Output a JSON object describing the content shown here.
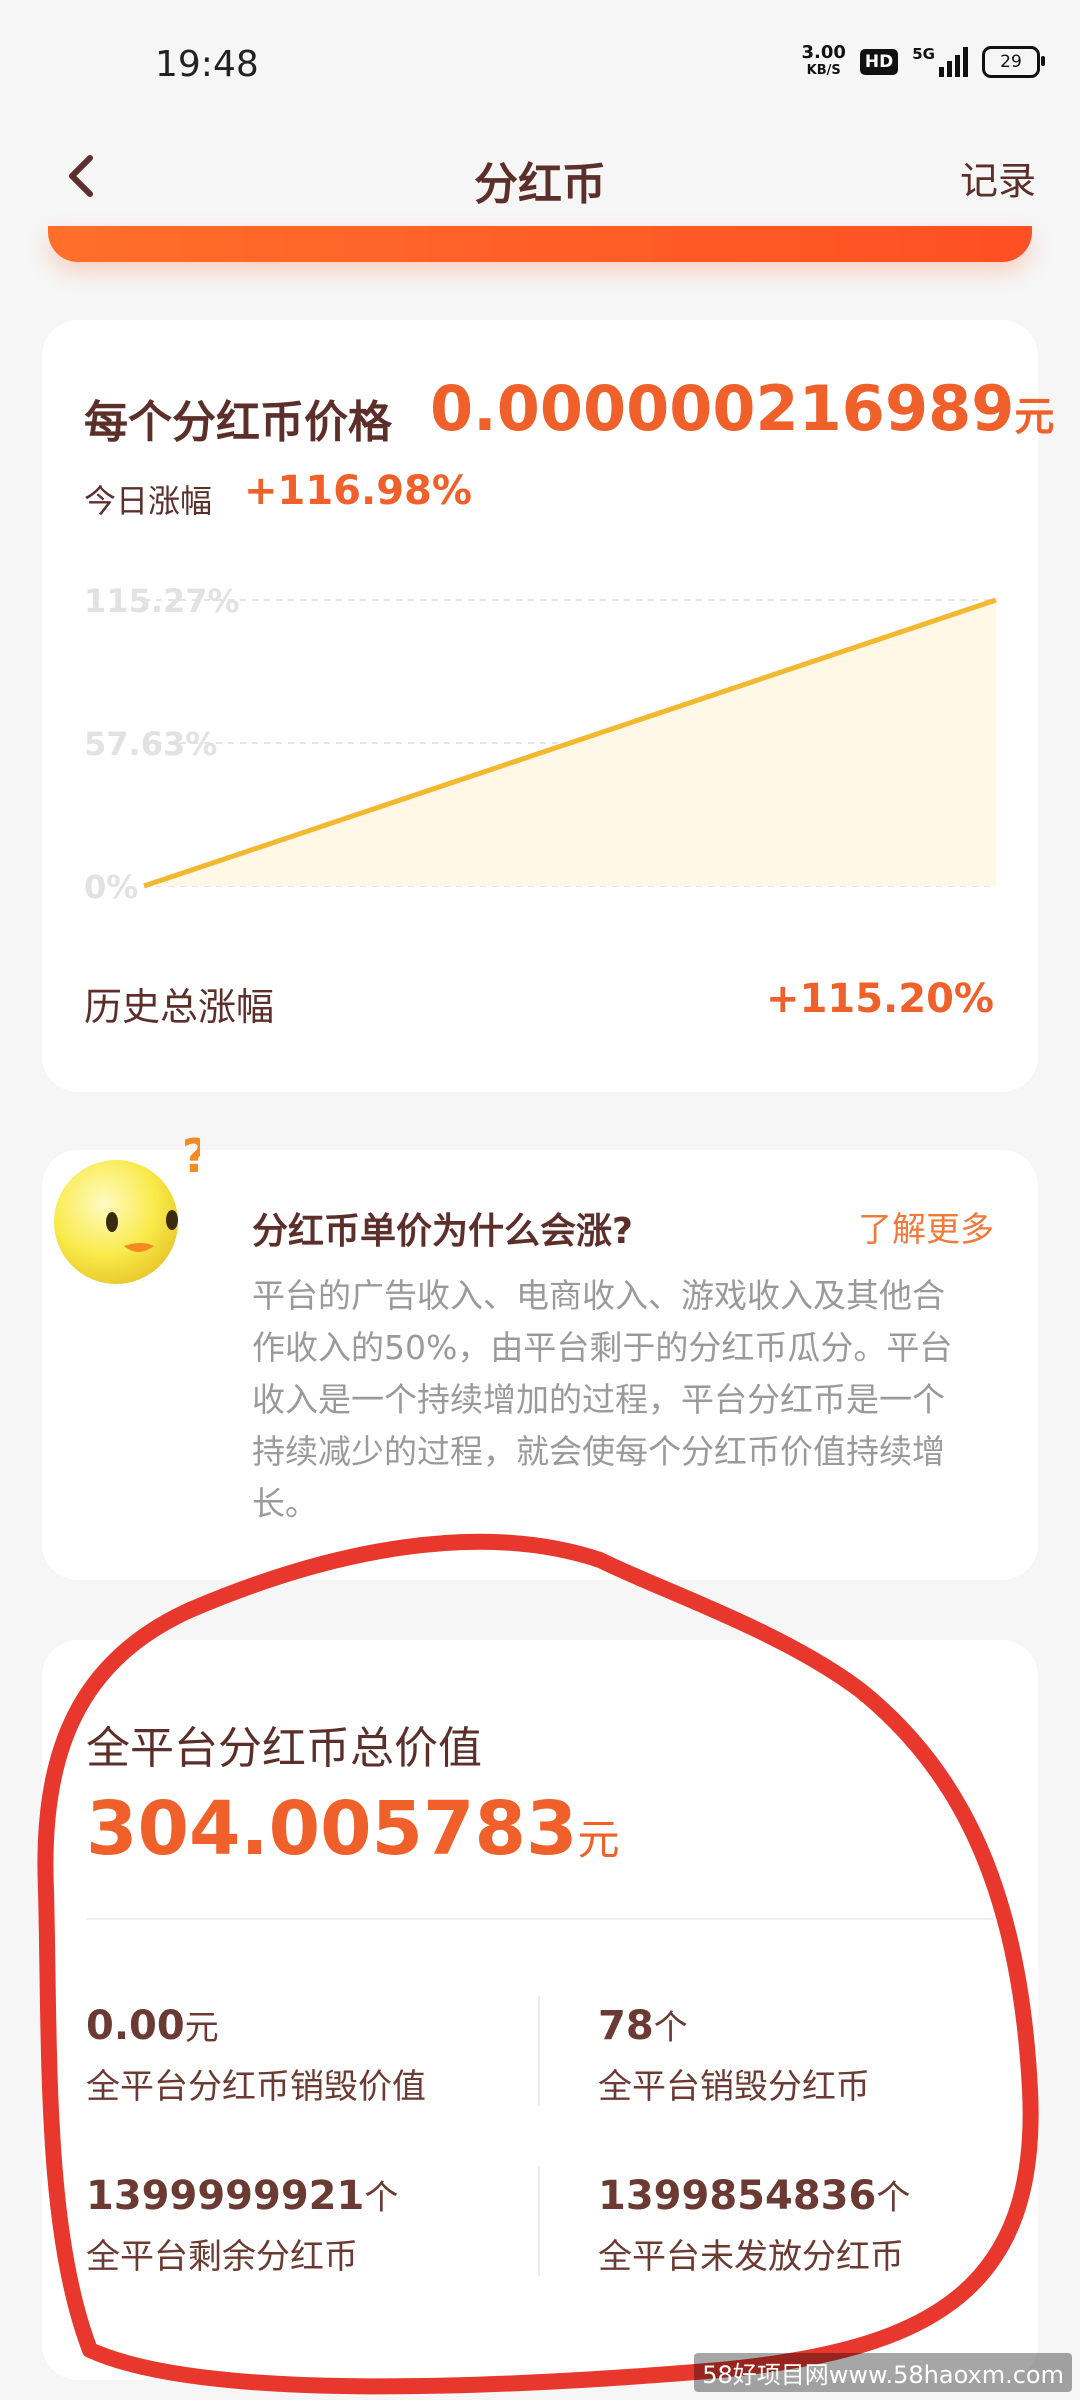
{
  "status_bar": {
    "time": "19:48",
    "net_speed_value": "3.00",
    "net_speed_unit": "KB/S",
    "hd_badge": "HD",
    "network_type": "5G",
    "battery": "29"
  },
  "header": {
    "back_icon": "chevron-left-icon",
    "title": "分红币",
    "record_label": "记录"
  },
  "price_card": {
    "price_label": "每个分红币价格",
    "price_value": "0.000000216989",
    "price_unit": "元",
    "today_label": "今日涨幅",
    "today_value": "+116.98%",
    "history_label": "历史总涨幅",
    "history_value": "+115.20%"
  },
  "chart_data": {
    "type": "area",
    "x": [
      0,
      1
    ],
    "values": [
      0,
      115.27
    ],
    "y_ticks": [
      "115.27%",
      "57.63%",
      "0%"
    ],
    "ylim": [
      0,
      115.27
    ],
    "grid": true,
    "line_color": "#f2b830",
    "fill_color": "#fff8e6"
  },
  "why_card": {
    "icon": "smiley-question-icon",
    "title": "分红币单价为什么会涨?",
    "learn_more": "了解更多",
    "lines": [
      "平台的广告收入、电商收入、游戏收入及其他合",
      "作收入的50%，由平台剩于的分红币瓜分。平台",
      "收入是一个持续增加的过程，平台分红币是一个",
      "持续减少的过程，就会使每个分红币价值持续增",
      "长。"
    ]
  },
  "total_card": {
    "label": "全平台分红币总价值",
    "value": "304.005783",
    "unit": "元",
    "stats": [
      {
        "value": "0.00",
        "unit": "元",
        "label": "全平台分红币销毁价值"
      },
      {
        "value": "78",
        "unit": "个",
        "label": "全平台销毁分红币"
      },
      {
        "value": "1399999921",
        "unit": "个",
        "label": "全平台剩余分红币"
      },
      {
        "value": "1399854836",
        "unit": "个",
        "label": "全平台未发放分红币"
      }
    ]
  },
  "watermark": "58好项目网www.58haoxm.com",
  "colors": {
    "accent": "#f0602a",
    "title_text": "#5c2f2b",
    "annotation_red": "#e8382e",
    "chart_line": "#f2b830"
  }
}
